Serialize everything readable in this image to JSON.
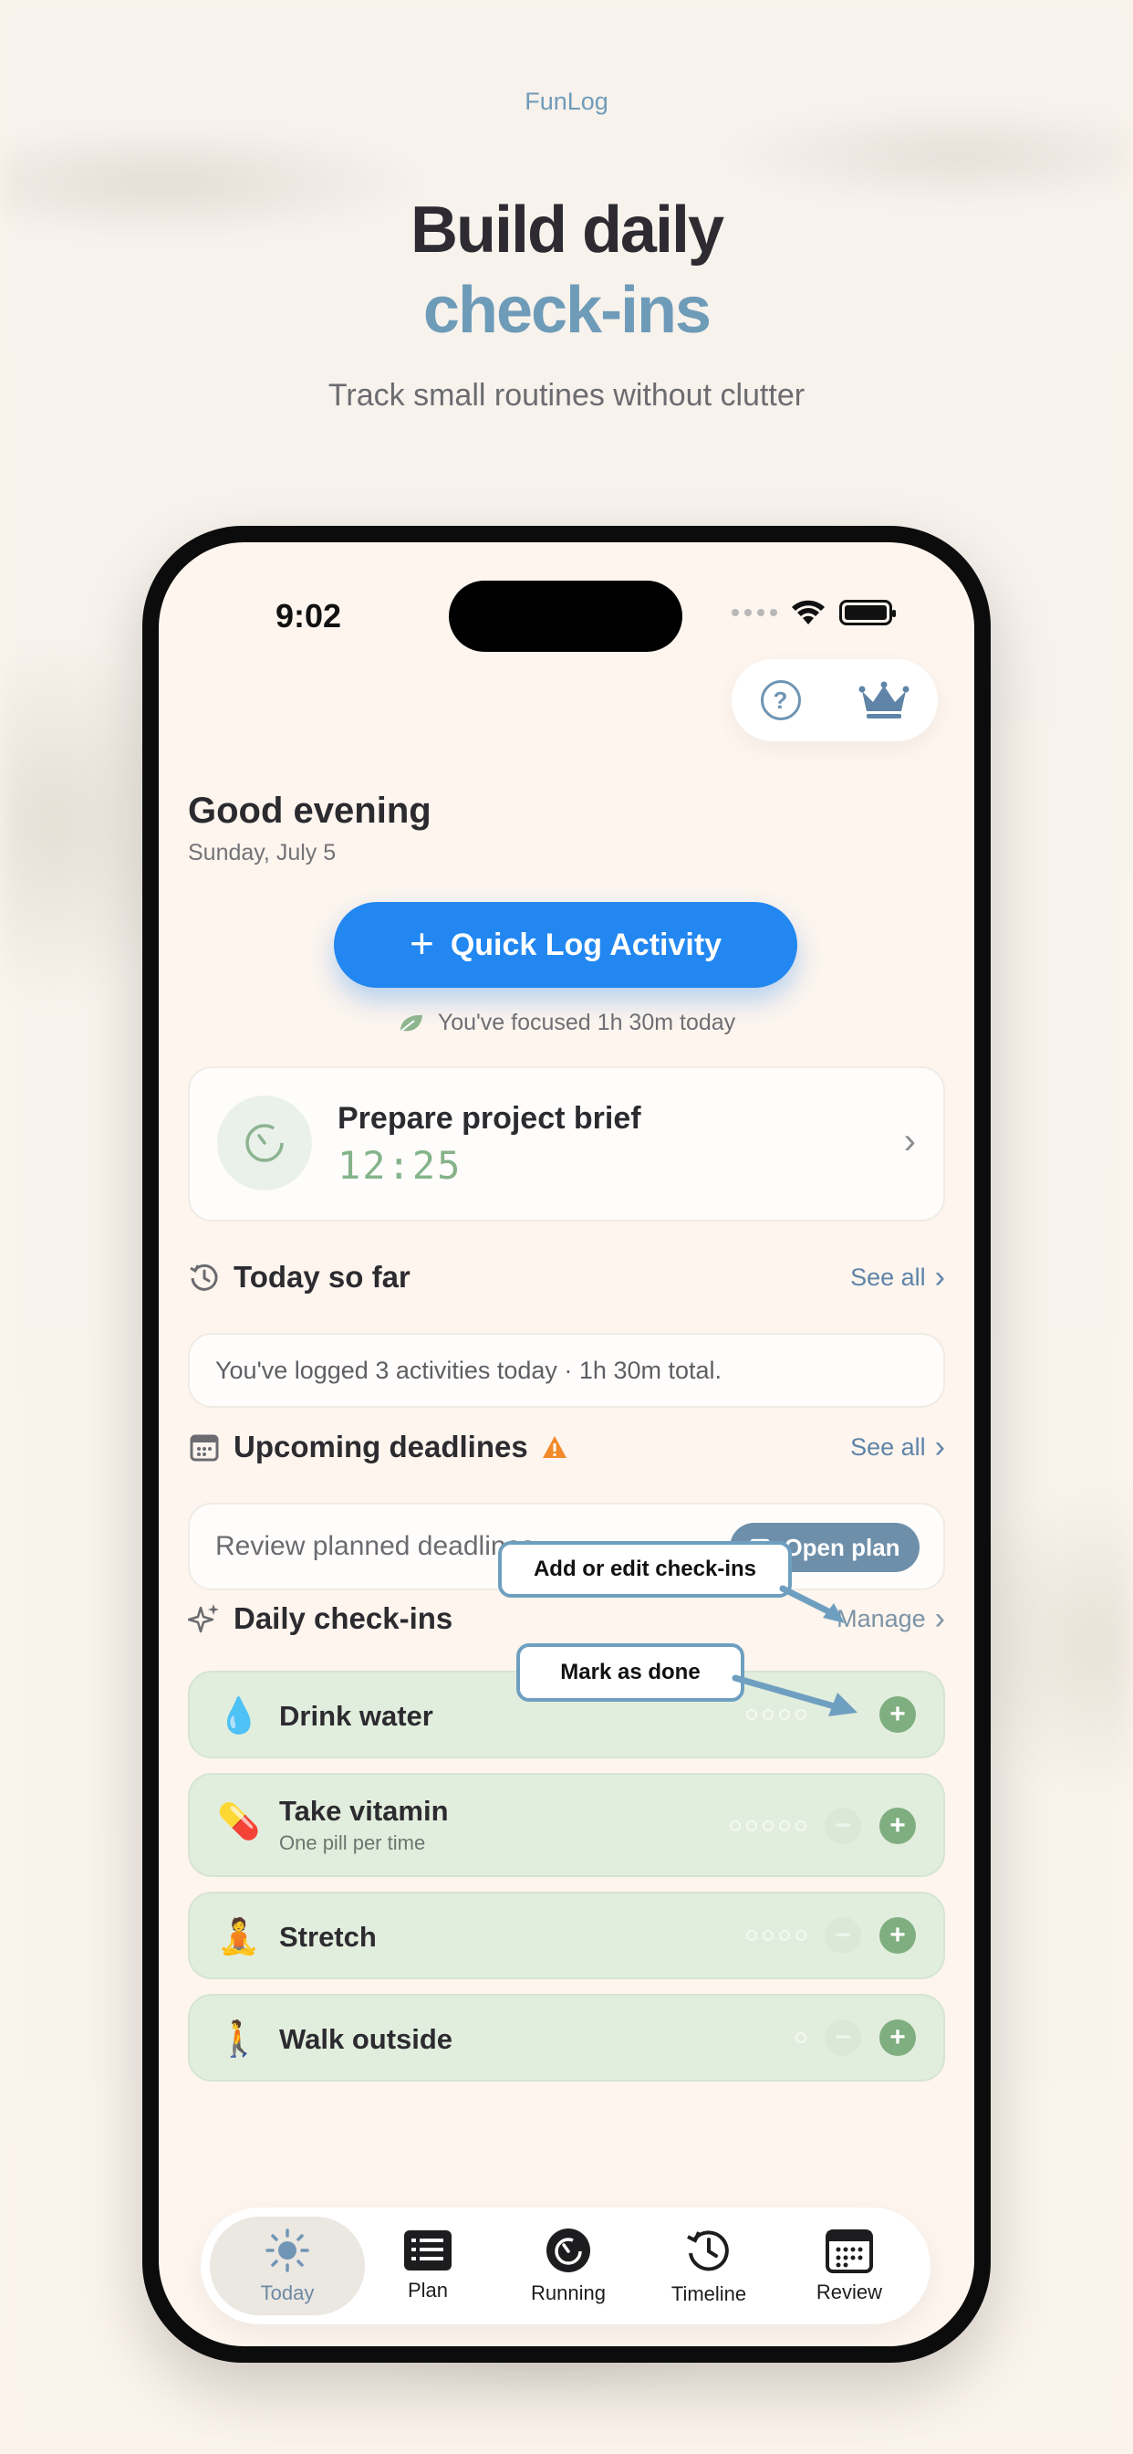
{
  "brand": "FunLog",
  "hero": {
    "title_line1": "Build daily",
    "title_line2": "check-ins",
    "subtitle": "Track small routines without clutter"
  },
  "status_bar": {
    "time": "9:02"
  },
  "greeting": {
    "title": "Good evening",
    "date": "Sunday, July 5"
  },
  "quick_log": {
    "label": "Quick Log Activity"
  },
  "focus_summary": "You've focused 1h 30m today",
  "running_timer": {
    "title": "Prepare project brief",
    "value": "12:25"
  },
  "today_so_far": {
    "title": "Today so far",
    "see_all": "See all",
    "summary": "You've logged 3 activities today · 1h 30m total."
  },
  "deadlines": {
    "title": "Upcoming deadlines",
    "see_all": "See all",
    "text": "Review planned deadlines",
    "open_plan": "Open plan"
  },
  "checkins": {
    "title": "Daily check-ins",
    "manage": "Manage",
    "items": [
      {
        "emoji": "💧",
        "name": "Drink water",
        "subtitle": "",
        "pips": 4
      },
      {
        "emoji": "💊",
        "name": "Take vitamin",
        "subtitle": "One pill per time",
        "pips": 5
      },
      {
        "emoji": "🧘",
        "name": "Stretch",
        "subtitle": "",
        "pips": 4
      },
      {
        "emoji": "🚶",
        "name": "Walk outside",
        "subtitle": "",
        "pips": 1
      }
    ]
  },
  "callouts": {
    "edit": "Add or edit check-ins",
    "done": "Mark as done"
  },
  "tabs": [
    {
      "label": "Today",
      "icon": "sun-icon",
      "active": true
    },
    {
      "label": "Plan",
      "icon": "list-icon",
      "active": false
    },
    {
      "label": "Running",
      "icon": "timer-icon",
      "active": false
    },
    {
      "label": "Timeline",
      "icon": "history-icon",
      "active": false
    },
    {
      "label": "Review",
      "icon": "calendar-icon",
      "active": false
    }
  ],
  "colors": {
    "accent_blue": "#2287f0",
    "brand_blue": "#6e9bb8",
    "checkin_green": "#e2eedd",
    "done_green": "#7fae80",
    "warning": "#f08a2a"
  }
}
